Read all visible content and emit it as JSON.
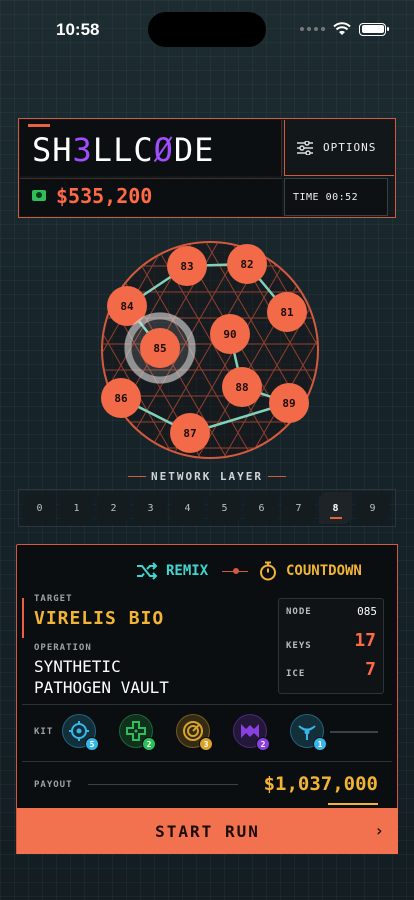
{
  "status_bar": {
    "time": "10:58"
  },
  "header": {
    "title_parts": [
      "SH",
      "3",
      "LLC",
      "Ø",
      "DE"
    ],
    "options_label": "OPTIONS",
    "money": "$535,200",
    "time_label": "TIME 00:52"
  },
  "network": {
    "nodes": [
      {
        "id": "83",
        "selected": false
      },
      {
        "id": "82",
        "selected": false
      },
      {
        "id": "84",
        "selected": false
      },
      {
        "id": "81",
        "selected": false
      },
      {
        "id": "90",
        "selected": false
      },
      {
        "id": "85",
        "selected": true
      },
      {
        "id": "88",
        "selected": false
      },
      {
        "id": "86",
        "selected": false
      },
      {
        "id": "89",
        "selected": false
      },
      {
        "id": "87",
        "selected": false
      }
    ],
    "links": [
      [
        "84",
        "83"
      ],
      [
        "83",
        "82"
      ],
      [
        "82",
        "81"
      ],
      [
        "84",
        "85"
      ],
      [
        "90",
        "88"
      ],
      [
        "88",
        "89"
      ],
      [
        "86",
        "87"
      ],
      [
        "87",
        "89"
      ]
    ],
    "label": "NETWORK LAYER",
    "layers": [
      "0",
      "1",
      "2",
      "3",
      "4",
      "5",
      "6",
      "7",
      "8",
      "9"
    ],
    "active_layer": "8"
  },
  "mission": {
    "remix_label": "REMIX",
    "countdown_label": "COUNTDOWN",
    "target_label": "TARGET",
    "target_value": "VIRELIS BIO",
    "operation_label": "OPERATION",
    "operation_line1": "SYNTHETIC",
    "operation_line2": "PATHOGEN VAULT",
    "node_label": "NODE",
    "node_value": "085",
    "keys_label": "KEYS",
    "keys_value": "17",
    "ice_label": "ICE",
    "ice_value": "7",
    "kit_label": "KIT",
    "kit": [
      {
        "icon": "crosshair-icon",
        "count": "5",
        "color": "#38b6e8"
      },
      {
        "icon": "dpad-icon",
        "count": "2",
        "color": "#2fbf5a"
      },
      {
        "icon": "radar-icon",
        "count": "3",
        "color": "#d9a22a"
      },
      {
        "icon": "mask-icon",
        "count": "2",
        "color": "#8a3fe0"
      },
      {
        "icon": "signal-icon",
        "count": "1",
        "color": "#38b6e8"
      }
    ],
    "payout_label": "PAYOUT",
    "payout_value": "$1,037,000",
    "start_label": "START RUN",
    "start_arrow": "›"
  },
  "colors": {
    "accent": "#e8623f",
    "gold": "#f2b434",
    "teal": "#3fd6cf",
    "purple": "#a24dff"
  }
}
